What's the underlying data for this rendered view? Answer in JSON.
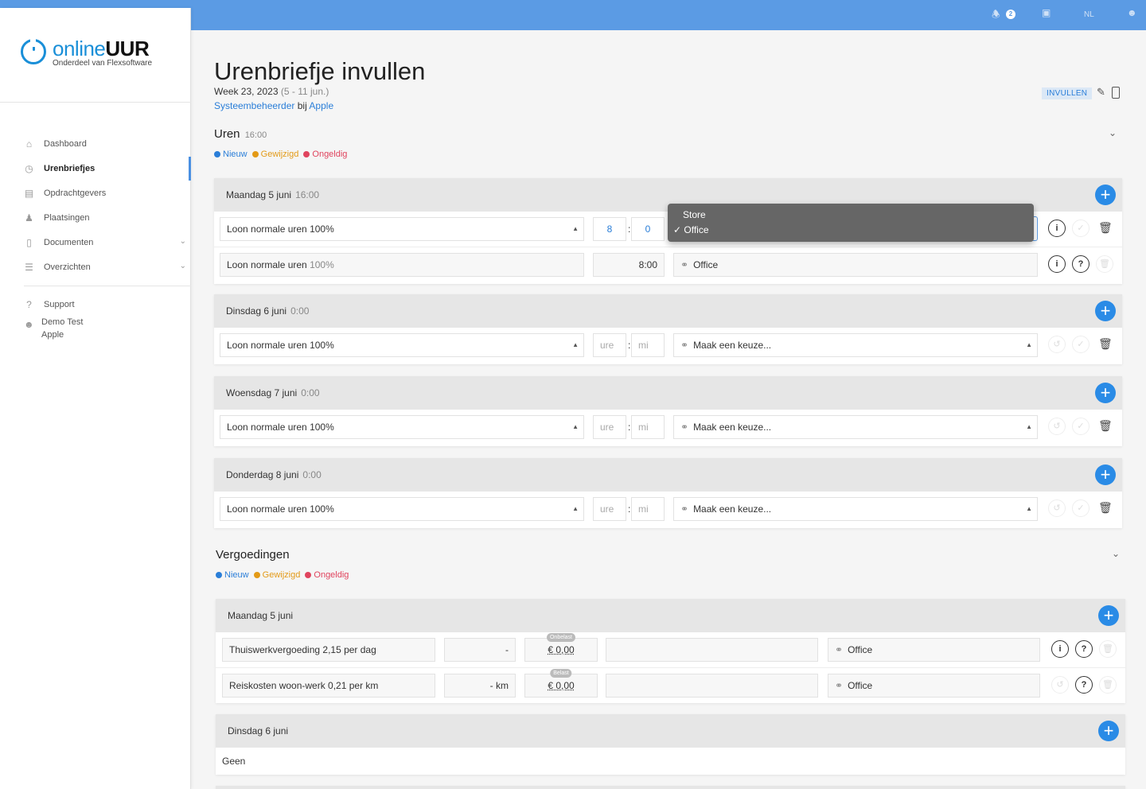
{
  "topbar": {
    "notification_count": "2",
    "language": "NL"
  },
  "logo": {
    "word_a": "online",
    "word_b": "UUR",
    "subtitle": "Onderdeel van Flexsoftware"
  },
  "nav": {
    "items": [
      {
        "label": "Dashboard",
        "icon": "home-icon"
      },
      {
        "label": "Urenbriefjes",
        "icon": "clock-icon",
        "active": true
      },
      {
        "label": "Opdrachtgevers",
        "icon": "building-icon"
      },
      {
        "label": "Plaatsingen",
        "icon": "person-pin-icon"
      },
      {
        "label": "Documenten",
        "icon": "document-icon"
      },
      {
        "label": "Overzichten",
        "icon": "list-icon"
      }
    ],
    "support": "Support",
    "user_name": "Demo Test",
    "user_company": "Apple"
  },
  "page": {
    "title": "Urenbriefje invullen",
    "week": "Week 23, 2023",
    "range": "(5 - 11 jun.)",
    "role": "Systeembeheerder",
    "at": "bij",
    "company": "Apple",
    "status_badge": "INVULLEN"
  },
  "hours": {
    "title": "Uren",
    "total": "16:00",
    "legend": {
      "new": "Nieuw",
      "modified": "Gewijzigd",
      "invalid": "Ongeldig"
    },
    "days": [
      {
        "name": "Maandag 5 juni",
        "total": "16:00",
        "rows": [
          {
            "type": "Loon normale uren 100%",
            "hours": "8",
            "minutes": "0",
            "project": "Office"
          },
          {
            "type_a": "Loon normale uren",
            "type_b": "100%",
            "duration": "8:00",
            "project": "Office"
          }
        ]
      },
      {
        "name": "Dinsdag 6 juni",
        "total": "0:00",
        "rows": [
          {
            "type": "Loon normale uren 100%",
            "hours_ph": "ure",
            "minutes_ph": "mi",
            "project": "Maak een keuze..."
          }
        ]
      },
      {
        "name": "Woensdag 7 juni",
        "total": "0:00",
        "rows": [
          {
            "type": "Loon normale uren 100%",
            "hours_ph": "ure",
            "minutes_ph": "mi",
            "project": "Maak een keuze..."
          }
        ]
      },
      {
        "name": "Donderdag 8 juni",
        "total": "0:00",
        "rows": [
          {
            "type": "Loon normale uren 100%",
            "hours_ph": "ure",
            "minutes_ph": "mi",
            "project": "Maak een keuze..."
          }
        ]
      }
    ],
    "dropdown_options": [
      "Store",
      "✓ Office"
    ]
  },
  "allowances": {
    "title": "Vergoedingen",
    "legend": {
      "new": "Nieuw",
      "modified": "Gewijzigd",
      "invalid": "Ongeldig"
    },
    "days": [
      {
        "name": "Maandag 5 juni",
        "rows": [
          {
            "type": "Thuiswerkvergoeding 2,15 per dag",
            "qty": "-",
            "pill": "Onbelast",
            "amount": "€ 0,00",
            "project": "Office"
          },
          {
            "type": "Reiskosten woon-werk 0,21 per km",
            "qty": "- km",
            "pill": "Belast",
            "amount": "€ 0,00",
            "project": "Office"
          }
        ]
      },
      {
        "name": "Dinsdag 6 juni",
        "empty": "Geen"
      }
    ]
  }
}
